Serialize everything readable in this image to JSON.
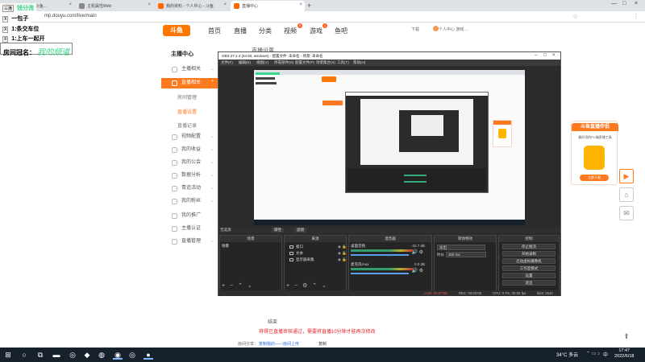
{
  "browser": {
    "tabs": [
      {
        "label": "找斗鱼直播_斗鱼..."
      },
      {
        "label": "主机属性Web"
      },
      {
        "label": "我的资料 - 个人中心 - 斗鱼"
      },
      {
        "label": "直播中心"
      }
    ],
    "url": "mp.douyu.com/live/main"
  },
  "overlay": {
    "lines": [
      {
        "badge": "三连",
        "text": "钱分流"
      },
      {
        "badge": "X",
        "text": "一包子"
      },
      {
        "badge": "X",
        "text": "1:条交车位"
      },
      {
        "badge": "X",
        "text": "1:上车一起开"
      }
    ],
    "room_label": "房间冠名：",
    "room_value": "我的频道"
  },
  "nav": {
    "logo": "斗鱼",
    "items": [
      "首页",
      "直播",
      "分类",
      "视频",
      "游戏",
      "鱼吧"
    ],
    "video_badge": "5",
    "game_badge": "1",
    "download": "下载",
    "user": "个人中心 游戏 ..."
  },
  "sidebar": {
    "title": "主播中心",
    "items": [
      {
        "label": "主播相关"
      },
      {
        "label": "直播相关"
      },
      {
        "label": "视频配置"
      },
      {
        "label": "我的收益"
      },
      {
        "label": "我的公会"
      },
      {
        "label": "数据分析"
      },
      {
        "label": "青追活动"
      },
      {
        "label": "我的粉丝"
      },
      {
        "label": "我的推广"
      },
      {
        "label": "主播认证"
      },
      {
        "label": "直播管理"
      }
    ],
    "subitems": [
      "房间管理",
      "直播设置",
      "直播记录"
    ]
  },
  "page": {
    "header_label": "直播设置",
    "note": "结束",
    "warning": "将得已直播审核通过，需要将直播10分钟才能再次修改",
    "share_label": "房间分享：",
    "share_link": "复制我的——房间上传",
    "copy": "复制"
  },
  "ad": {
    "title": "斗鱼直播伴侣",
    "subtitle": "最好用的PC端直播工具",
    "button": "立即下载"
  },
  "obs": {
    "title": "OBS 27.1.3 (64-bit, windows) - 配置文件: 未命名 - 场景: 未命名",
    "menu": [
      "文件(F)",
      "编辑(E)",
      "视图(V)",
      "停靠部件(D)",
      "配置文件(P)",
      "场景集合(S)",
      "工具(T)",
      "帮助(H)"
    ],
    "status_label": "无选源",
    "status_buttons": [
      "属性",
      "滤镜"
    ],
    "docks": {
      "scenes": {
        "title": "场景",
        "items": [
          "场景"
        ]
      },
      "sources": {
        "title": "来源",
        "items": [
          "窗口",
          "文本",
          "显示器采集"
        ]
      },
      "mixer": {
        "title": "混音器",
        "channels": [
          {
            "name": "桌面音频",
            "db": "-32.7 dB"
          },
          {
            "name": "麦克风/Aux",
            "db": "0.0 dB"
          }
        ]
      },
      "transitions": {
        "title": "转场特效",
        "fade": "淡出",
        "duration_label": "时长",
        "duration": "300 ms"
      },
      "controls": {
        "title": "控制",
        "buttons": [
          "停止推流",
          "开始录制",
          "启动虚拟摄像机",
          "工作室模式",
          "设置",
          "退出"
        ]
      }
    },
    "statusbar": {
      "live": "LIVE: 00:07:58",
      "rec": "REC: 00:00:00",
      "cpu": "CPU: 0.7%, 30.00 fps",
      "kbps": "kb/s: 2542"
    }
  },
  "taskbar": {
    "weather": "34°C 多云",
    "lang": "中",
    "time": "17:47",
    "date": "2022/6/18"
  },
  "colors": {
    "accent": "#ff7a1f",
    "obs_bg": "#2b2b2b",
    "overlay_green": "#3dd68c"
  }
}
